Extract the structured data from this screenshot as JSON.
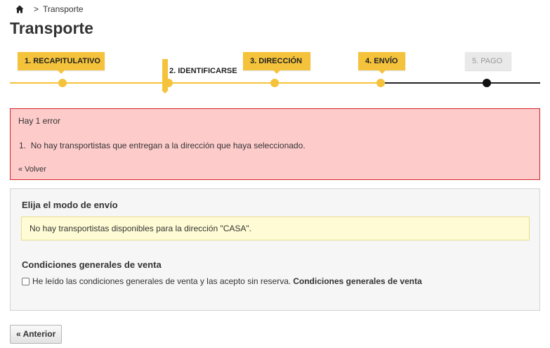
{
  "breadcrumb": {
    "separator": ">",
    "current": "Transporte"
  },
  "page_title": "Transporte",
  "steps": [
    {
      "label": "1. RECAPITULATIVO",
      "state": "done"
    },
    {
      "label": "2. IDENTIFICARSE",
      "state": "current"
    },
    {
      "label": "3. DIRECCIÓN",
      "state": "done"
    },
    {
      "label": "4. ENVÍO",
      "state": "done"
    },
    {
      "label": "5. PAGO",
      "state": "todo"
    }
  ],
  "error": {
    "title": "Hay 1 error",
    "item_number": "1.",
    "item_text": "No hay transportistas que entregan a la dirección que haya seleccionado.",
    "back_link": "« Volver"
  },
  "shipping": {
    "heading": "Elija el modo de envío",
    "warning": "No hay transportistas disponibles para la dirección \"CASA\"."
  },
  "terms": {
    "heading": "Condiciones generales de venta",
    "checkbox_label": "He leído las condiciones generales de venta y las acepto sin reserva.",
    "link": "Condiciones generales de venta",
    "checked": false
  },
  "previous_button": "« Anterior",
  "colors": {
    "accent": "#f5c33b",
    "error_bg": "#fecbcb",
    "error_border": "#d4242b",
    "warning_bg": "#fffcd5"
  }
}
